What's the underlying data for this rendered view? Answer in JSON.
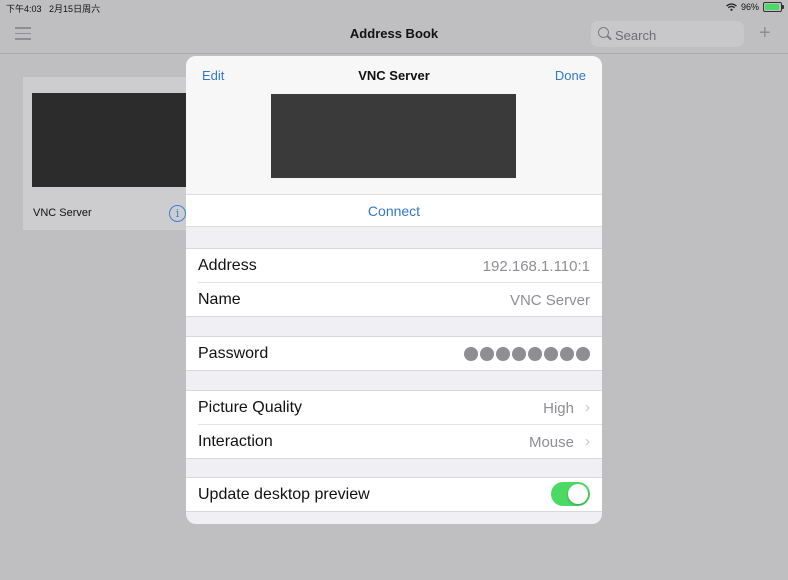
{
  "status": {
    "time": "下午4:03",
    "date": "2月15日周六",
    "battery": "96%",
    "battery_level": 0.96
  },
  "nav": {
    "title": "Address Book",
    "search_placeholder": "Search",
    "add_label": "+"
  },
  "card": {
    "label": "VNC Server",
    "info_label": "i"
  },
  "modal": {
    "edit_label": "Edit",
    "title": "VNC Server",
    "done_label": "Done",
    "connect_label": "Connect",
    "address": {
      "label": "Address",
      "value": "192.168.1.110:1"
    },
    "name": {
      "label": "Name",
      "value": "VNC Server"
    },
    "password": {
      "label": "Password",
      "dot_count": 8
    },
    "picture_quality": {
      "label": "Picture Quality",
      "value": "High"
    },
    "interaction": {
      "label": "Interaction",
      "value": "Mouse"
    },
    "update_preview": {
      "label": "Update desktop preview",
      "enabled": true
    }
  },
  "colors": {
    "accent": "#3478c6",
    "toggle_on": "#4cd964",
    "background": "#bfbfc1"
  },
  "icons": [
    "menu-icon",
    "search-icon",
    "plus-icon",
    "info-icon",
    "chevron-right-icon",
    "wifi-icon",
    "battery-icon"
  ]
}
